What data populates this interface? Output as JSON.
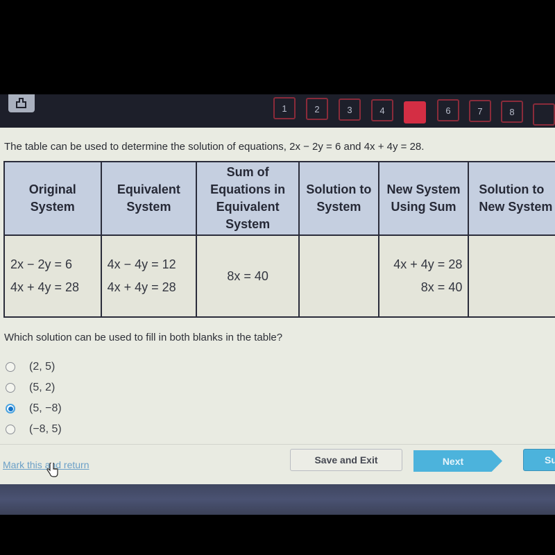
{
  "toolbar": {
    "print_icon": "print-icon",
    "question_nav": [
      {
        "label": "1",
        "state": "default"
      },
      {
        "label": "2",
        "state": "default"
      },
      {
        "label": "3",
        "state": "default"
      },
      {
        "label": "4",
        "state": "default"
      },
      {
        "label": "",
        "state": "current"
      },
      {
        "label": "6",
        "state": "default"
      },
      {
        "label": "7",
        "state": "default"
      },
      {
        "label": "8",
        "state": "default"
      },
      {
        "label": "",
        "state": "default"
      }
    ],
    "colors": {
      "current": "#d42e44",
      "border": "#8a2b3a"
    }
  },
  "prompt": {
    "text_before": "The table can be used to determine the solution of equations, ",
    "eq1": "2x − 2y = 6",
    "and": " and ",
    "eq2": "4x + 4y = 28",
    "end": "."
  },
  "table": {
    "headers": [
      "Original System",
      "Equivalent System",
      "Sum of Equations in Equivalent System",
      "Solution to System",
      "New System Using Sum",
      "Solution to New System"
    ],
    "row": {
      "original": [
        "2x − 2y = 6",
        "4x + 4y = 28"
      ],
      "equivalent": [
        "4x − 4y = 12",
        "4x + 4y = 28"
      ],
      "sum": "8x = 40",
      "solution": "",
      "new_system": [
        "4x + 4y = 28",
        "8x = 40"
      ],
      "new_solution": ""
    }
  },
  "question": "Which solution can be used to fill in both blanks in the table?",
  "options": [
    {
      "label": "(2, 5)",
      "selected": false
    },
    {
      "label": "(5, 2)",
      "selected": false
    },
    {
      "label": "(5, −8)",
      "selected": true
    },
    {
      "label": "(−8, 5)",
      "selected": false
    }
  ],
  "footer": {
    "mark_link": "Mark this and return",
    "save_exit": "Save and Exit",
    "next": "Next",
    "submit": "Su"
  },
  "accent_color": "#4cb3dc"
}
